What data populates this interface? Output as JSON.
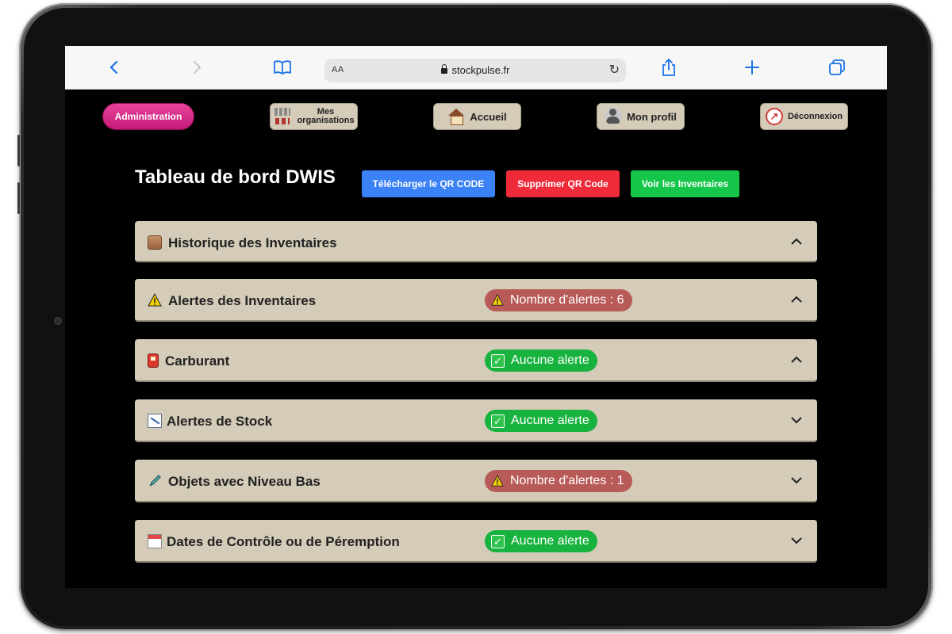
{
  "browser": {
    "url": "stockpulse.fr",
    "text_size_label": "AA"
  },
  "nav": {
    "admin": "Administration",
    "orgs_line1": "Mes",
    "orgs_line2": "organisations",
    "home": "Accueil",
    "profile": "Mon profil",
    "logout": "Déconnexion"
  },
  "page": {
    "title": "Tableau de bord DWIS",
    "actions": {
      "download_qr": "Télécharger le QR CODE",
      "delete_qr": "Supprimer QR Code",
      "view_inventories": "Voir les Inventaires"
    }
  },
  "sections": [
    {
      "title": "Historique des Inventaires",
      "icon": "box-icon",
      "badge": null,
      "expanded": true
    },
    {
      "title": "Alertes des Inventaires",
      "icon": "warning-icon",
      "badge": "Nombre d'alertes : 6",
      "badge_type": "alert",
      "expanded": true
    },
    {
      "title": "Carburant",
      "icon": "fuel-pump-icon",
      "badge": "Aucune alerte",
      "badge_type": "ok",
      "expanded": true
    },
    {
      "title": "Alertes de Stock",
      "icon": "chart-down-icon",
      "badge": "Aucune alerte",
      "badge_type": "ok",
      "expanded": false
    },
    {
      "title": "Objets avec Niveau Bas",
      "icon": "pipette-icon",
      "badge": "Nombre d'alertes : 1",
      "badge_type": "alert",
      "expanded": false
    },
    {
      "title": "Dates de Contrôle ou de Péremption",
      "icon": "calendar-icon",
      "badge": "Aucune alerte",
      "badge_type": "ok",
      "expanded": false
    }
  ],
  "colors": {
    "accent_pink": "#d62a86",
    "panel": "#d4cbb8",
    "alert_badge": "#b85a58",
    "ok_badge": "#17b33e",
    "blue_button": "#3b82f6",
    "red_button": "#ef2b3a",
    "green_button": "#16c64a"
  }
}
